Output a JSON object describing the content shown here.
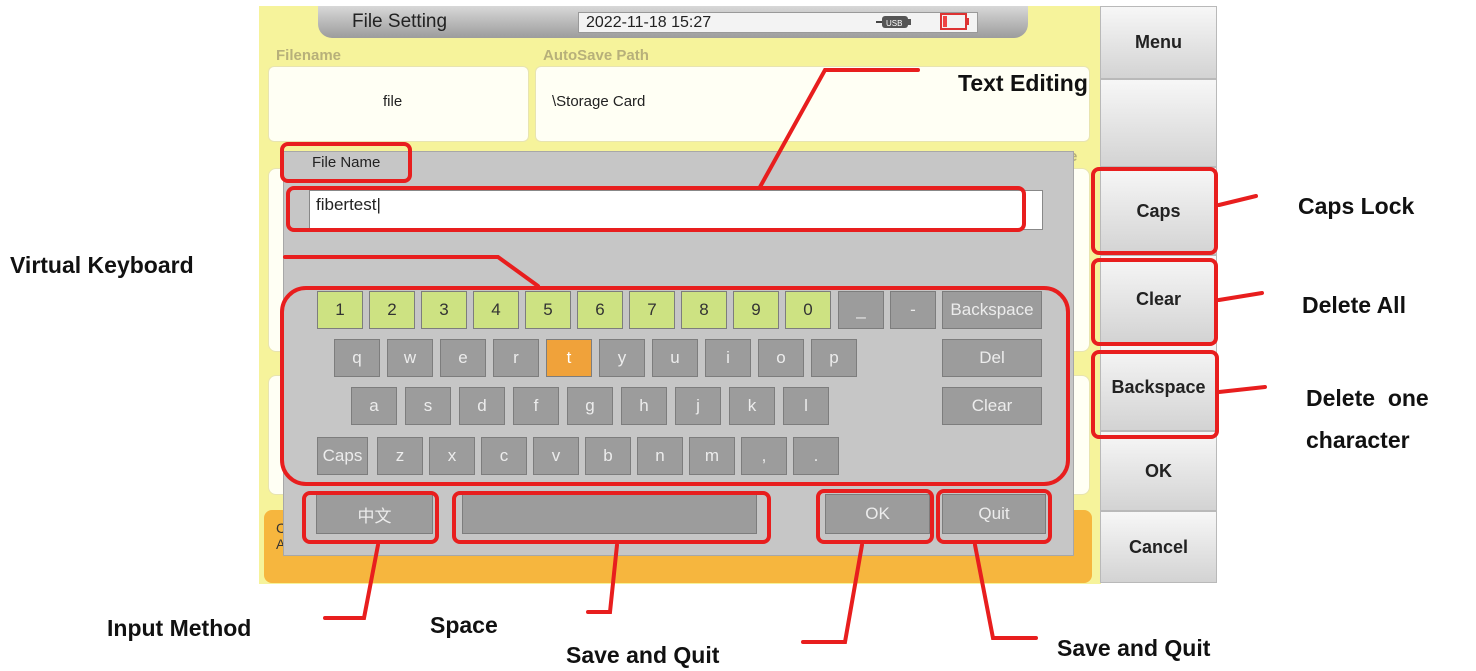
{
  "header": {
    "title": "File Setting",
    "datetime": "2022-11-18 15:27",
    "usb_label": "USB",
    "usb_icon": "usb-icon",
    "battery_icon": "battery-icon"
  },
  "fields": {
    "filename_label": "Filename",
    "filename_value": "file",
    "autosave_label": "AutoSave Path",
    "autosave_value": "\\Storage Card",
    "partial_e": "e",
    "partial_c": "C",
    "partial_a": "A"
  },
  "side_menu": {
    "menu": "Menu",
    "caps": "Caps",
    "clear": "Clear",
    "backspace": "Backspace",
    "ok": "OK",
    "cancel": "Cancel"
  },
  "dialog": {
    "title": "File Name",
    "input_value": "fibertest|",
    "number_keys": [
      "1",
      "2",
      "3",
      "4",
      "5",
      "6",
      "7",
      "8",
      "9",
      "0"
    ],
    "underscore": "_",
    "dash": "-",
    "backspace": "Backspace",
    "row_q": [
      "q",
      "w",
      "e",
      "r",
      "t",
      "y",
      "u",
      "i",
      "o",
      "p"
    ],
    "del": "Del",
    "row_a": [
      "a",
      "s",
      "d",
      "f",
      "g",
      "h",
      "j",
      "k",
      "l"
    ],
    "clear": "Clear",
    "caps": "Caps",
    "row_z": [
      "z",
      "x",
      "c",
      "v",
      "b",
      "n",
      "m",
      ",",
      "."
    ],
    "ime": "中文",
    "ok": "OK",
    "quit": "Quit",
    "active_key": "t"
  },
  "annotations": {
    "text_editing": "Text Editing",
    "caps_lock": "Caps Lock",
    "delete_all": "Delete All",
    "delete_one_line1": "Delete  one",
    "delete_one_line2": "character",
    "virtual_keyboard": "Virtual Keyboard",
    "input_method": "Input Method",
    "space": "Space",
    "save_and_quit_1": "Save and Quit",
    "save_and_quit_2": "Save and Quit"
  },
  "colors": {
    "screen_bg": "#f6f39b",
    "annotation_red": "#e81e1e",
    "key_gray": "#9c9c9c",
    "number_key_green": "#cde282",
    "active_key_orange": "#f0a23a",
    "status_bar_orange": "#f6b63e"
  }
}
